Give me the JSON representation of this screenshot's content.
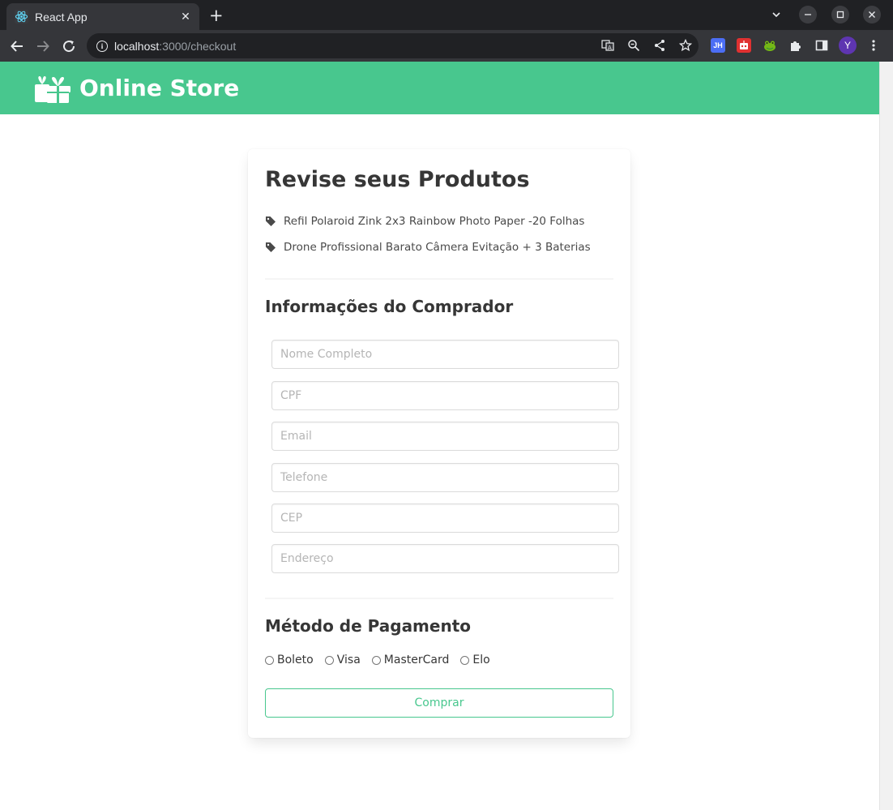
{
  "browser": {
    "tab_title": "React App",
    "tab_close": "✕",
    "new_tab": "+",
    "url_host": "localhost",
    "url_path": ":3000/checkout",
    "profile_initial": "Y",
    "extensions": [
      {
        "name": "jh-extension",
        "label": "JH",
        "color": "#4c6ef5"
      },
      {
        "name": "robot-extension",
        "label": "",
        "color": "#e03131"
      },
      {
        "name": "frog-extension",
        "label": "",
        "color": "#5c940d"
      }
    ]
  },
  "header": {
    "brand": "Online Store",
    "color": "#48c78e"
  },
  "review": {
    "title": "Revise seus Produtos",
    "products": [
      "Refil Polaroid Zink 2x3 Rainbow Photo Paper -20 Folhas",
      "Drone Profissional Barato Câmera Evitação + 3 Baterias"
    ]
  },
  "buyer": {
    "title": "Informações do Comprador",
    "fields": {
      "name_placeholder": "Nome Completo",
      "cpf_placeholder": "CPF",
      "email_placeholder": "Email",
      "phone_placeholder": "Telefone",
      "cep_placeholder": "CEP",
      "address_placeholder": "Endereço"
    }
  },
  "payment": {
    "title": "Método de Pagamento",
    "options": [
      "Boleto",
      "Visa",
      "MasterCard",
      "Elo"
    ]
  },
  "submit_label": "Comprar"
}
